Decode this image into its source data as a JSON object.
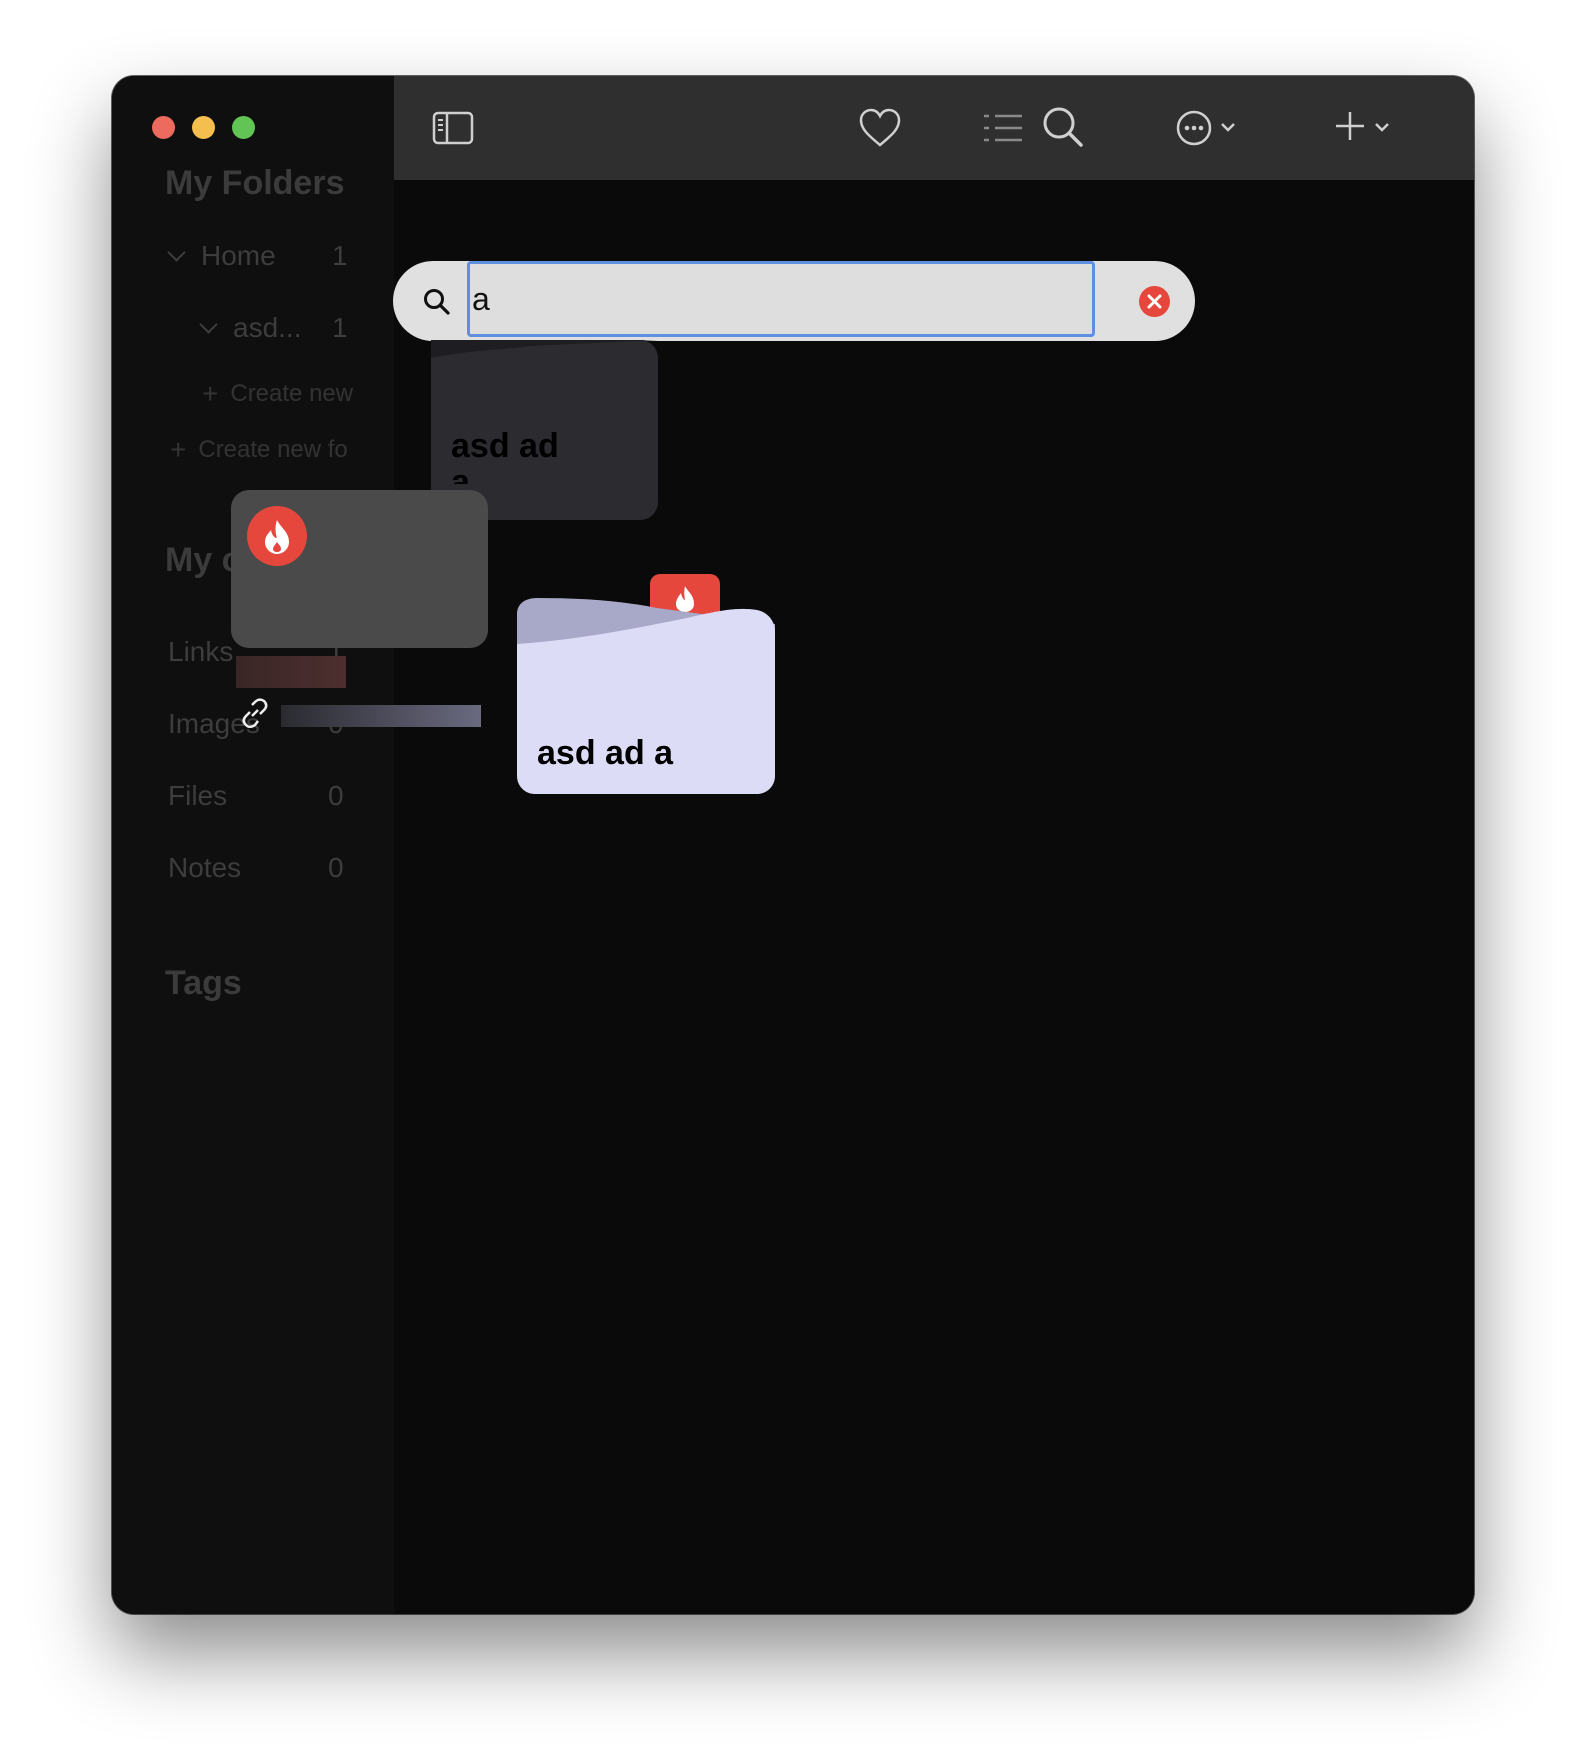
{
  "sidebar": {
    "folders_heading": "My Folders",
    "tree": [
      {
        "label": "Home",
        "count": "1"
      },
      {
        "label": "asd...",
        "count": "1"
      }
    ],
    "create_new_sub": "Create new",
    "create_new_folder": "Create new fo",
    "collections_heading": "My c",
    "collections": [
      {
        "label": "Links",
        "count": "1"
      },
      {
        "label": "Images",
        "count": "0"
      },
      {
        "label": "Files",
        "count": "0"
      },
      {
        "label": "Notes",
        "count": "0"
      }
    ],
    "tags_heading": "Tags"
  },
  "toolbar": {
    "icons": [
      "sidebar-toggle-icon",
      "heart-icon",
      "list-icon",
      "search-icon",
      "more-icon",
      "chevron-down-icon",
      "plus-icon",
      "chevron-down-icon"
    ]
  },
  "search": {
    "value": "a"
  },
  "cards": [
    {
      "title": "asd ad a"
    },
    {
      "title": "asd ad a"
    }
  ],
  "colors": {
    "accent": "#5f8fe0",
    "folder_card": "#dcdcf7",
    "brand_red": "#e5473d"
  }
}
